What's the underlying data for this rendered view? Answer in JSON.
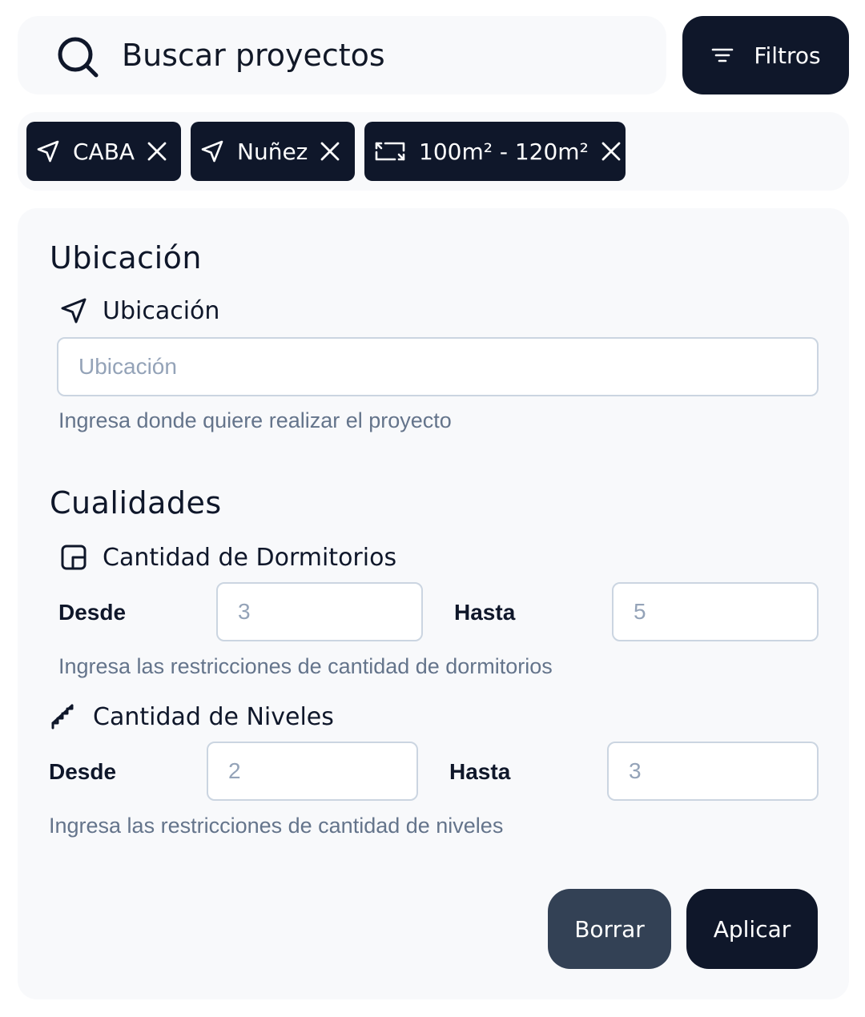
{
  "search": {
    "placeholder": "Buscar proyectos",
    "filters_label": "Filtros"
  },
  "chips": [
    {
      "label": "CABA",
      "icon": "location-arrow-icon"
    },
    {
      "label": "Nuñez",
      "icon": "location-arrow-icon"
    },
    {
      "label": "100m² - 120m²",
      "icon": "area-resize-icon"
    }
  ],
  "location": {
    "section_title": "Ubicación",
    "field_label": "Ubicación",
    "placeholder": "Ubicación",
    "help": "Ingresa donde quiere realizar el proyecto"
  },
  "qualities": {
    "section_title": "Cualidades",
    "bedrooms": {
      "label": "Cantidad de Dormitorios",
      "from_label": "Desde",
      "from_placeholder": "3",
      "to_label": "Hasta",
      "to_placeholder": "5",
      "help": "Ingresa las restricciones de cantidad de dormitorios"
    },
    "levels": {
      "label": "Cantidad de Niveles",
      "from_label": "Desde",
      "from_placeholder": "2",
      "to_label": "Hasta",
      "to_placeholder": "3",
      "help": "Ingresa las restricciones de cantidad de niveles"
    }
  },
  "actions": {
    "clear_label": "Borrar",
    "apply_label": "Aplicar"
  },
  "colors": {
    "primary": "#0f172a",
    "secondary": "#334155",
    "panel": "#f8f9fb",
    "muted": "#64748b",
    "border": "#cbd5e1"
  }
}
